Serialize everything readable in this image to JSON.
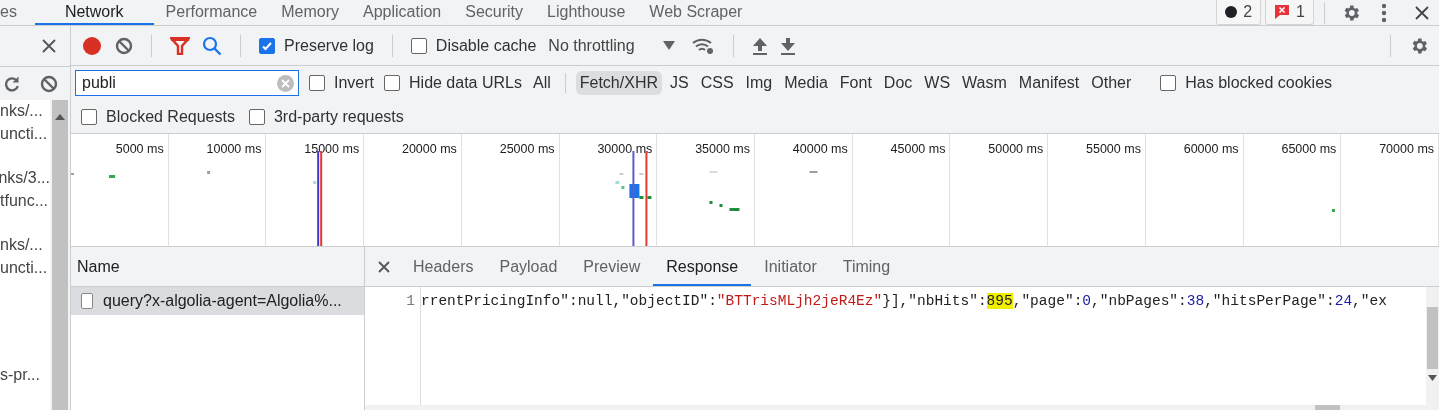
{
  "panel_tabs": [
    {
      "label": "es",
      "selected": false
    },
    {
      "label": "Network",
      "selected": true
    },
    {
      "label": "Performance",
      "selected": false
    },
    {
      "label": "Memory",
      "selected": false
    },
    {
      "label": "Application",
      "selected": false
    },
    {
      "label": "Security",
      "selected": false
    },
    {
      "label": "Lighthouse",
      "selected": false
    },
    {
      "label": "Web Scraper",
      "selected": false
    }
  ],
  "counters": [
    {
      "kind": "messages",
      "count": "2"
    },
    {
      "kind": "errors",
      "count": "1"
    }
  ],
  "toolbar": {
    "recording": true,
    "preserve_log": {
      "label": "Preserve log",
      "checked": true
    },
    "disable_cache": {
      "label": "Disable cache",
      "checked": false
    },
    "throttling": "No throttling"
  },
  "filter": {
    "value": "publi",
    "invert": {
      "label": "Invert",
      "checked": false
    },
    "hide_data_urls": {
      "label": "Hide data URLs",
      "checked": false
    },
    "types": [
      {
        "label": "All",
        "selected": false
      },
      {
        "label": "Fetch/XHR",
        "selected": true
      },
      {
        "label": "JS",
        "selected": false
      },
      {
        "label": "CSS",
        "selected": false
      },
      {
        "label": "Img",
        "selected": false
      },
      {
        "label": "Media",
        "selected": false
      },
      {
        "label": "Font",
        "selected": false
      },
      {
        "label": "Doc",
        "selected": false
      },
      {
        "label": "WS",
        "selected": false
      },
      {
        "label": "Wasm",
        "selected": false
      },
      {
        "label": "Manifest",
        "selected": false
      },
      {
        "label": "Other",
        "selected": false
      }
    ],
    "has_blocked_cookies": {
      "label": "Has blocked cookies",
      "checked": false
    },
    "blocked_requests": {
      "label": "Blocked Requests",
      "checked": false
    },
    "third_party": {
      "label": "3rd-party requests",
      "checked": false
    }
  },
  "sidebar": {
    "groups": [
      [
        "nks/...",
        "uncti..."
      ],
      [
        "nks/3...",
        "tfunc..."
      ],
      [
        "nks/...",
        "uncti..."
      ],
      [
        "s-pr..."
      ]
    ]
  },
  "overview": {
    "ticks": [
      "5000 ms",
      "10000 ms",
      "15000 ms",
      "20000 ms",
      "25000 ms",
      "30000 ms",
      "35000 ms",
      "40000 ms",
      "45000 ms",
      "50000 ms",
      "55000 ms",
      "60000 ms",
      "65000 ms",
      "70000 ms"
    ]
  },
  "requests": {
    "column": "Name",
    "rows": [
      {
        "name": "query?x-algolia-agent=Algolia%...",
        "selected": true
      }
    ]
  },
  "details": {
    "tabs": [
      {
        "label": "Headers",
        "selected": false
      },
      {
        "label": "Payload",
        "selected": false
      },
      {
        "label": "Preview",
        "selected": false
      },
      {
        "label": "Response",
        "selected": true
      },
      {
        "label": "Initiator",
        "selected": false
      },
      {
        "label": "Timing",
        "selected": false
      }
    ],
    "line_number": "1",
    "tokens": [
      {
        "kind": "plain",
        "text": "rrentPricingInfo\":null,\"objectID\":"
      },
      {
        "kind": "string",
        "text": "\"BTTrisMLjh2jeR4Ez\""
      },
      {
        "kind": "plain",
        "text": "}],\"nbHits\":"
      },
      {
        "kind": "match",
        "text": "895"
      },
      {
        "kind": "plain",
        "text": ",\"page\":"
      },
      {
        "kind": "number",
        "text": "0"
      },
      {
        "kind": "plain",
        "text": ",\"nbPages\":"
      },
      {
        "kind": "number",
        "text": "38"
      },
      {
        "kind": "plain",
        "text": ",\"hitsPerPage\":"
      },
      {
        "kind": "number",
        "text": "24"
      },
      {
        "kind": "plain",
        "text": ",\"ex"
      }
    ]
  }
}
